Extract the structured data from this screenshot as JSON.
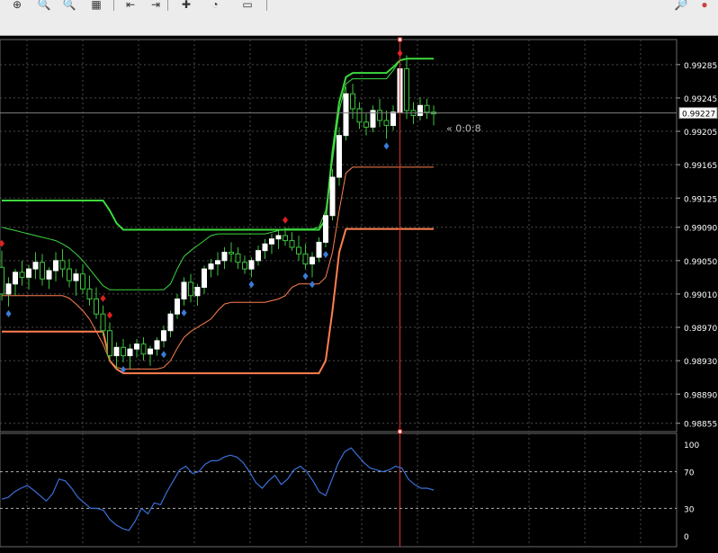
{
  "toolbar": {
    "buttons": [
      {
        "icon": "crosshair-icon",
        "glyph": "⊕"
      },
      {
        "icon": "zoom-in-icon",
        "glyph": "🔍"
      },
      {
        "icon": "zoom-out-icon",
        "glyph": "🔍"
      },
      {
        "icon": "tile-windows-icon",
        "glyph": "▦"
      },
      {
        "icon": "chart-shift-icon",
        "glyph": "⇤"
      },
      {
        "icon": "auto-scroll-icon",
        "glyph": "⇥"
      },
      {
        "icon": "indicators-icon",
        "glyph": "✚"
      },
      {
        "icon": "periods-icon",
        "glyph": "◔"
      },
      {
        "icon": "templates-icon",
        "glyph": "▭"
      }
    ],
    "right_icons": [
      {
        "icon": "search-icon",
        "glyph": "🔎"
      },
      {
        "icon": "notifications-icon",
        "glyph": "●"
      }
    ]
  },
  "colors": {
    "background": "#000000",
    "grid": "#4a4a4a",
    "candle_up": "#ffffff",
    "candle_down": "#ffffff",
    "wick": "#3cc43c",
    "outer_upper": "#3ed83e",
    "outer_lower": "#ff7f50",
    "inner_upper": "#3ed83e",
    "inner_lower": "#ff7f50",
    "signal_up": "#3a7bd5",
    "signal_down": "#e02020",
    "indicator_line": "#3b6fd8",
    "vertical_line": "#e03030",
    "price_line": "#808080",
    "axis_text": "#ffffff"
  },
  "chart_data": [
    {
      "type": "candlestick",
      "y_ticks": [
        "0.99285",
        "0.99245",
        "0.99205",
        "0.99165",
        "0.99125",
        "0.99090",
        "0.99050",
        "0.99010",
        "0.98970",
        "0.98930",
        "0.98890",
        "0.98855"
      ],
      "ylim": [
        0.98845,
        0.99315
      ],
      "current_price": "0.99227",
      "timer_label": "« 0:0:8",
      "candles": [
        [
          0.99042,
          0.99062,
          0.99002,
          0.9901
        ],
        [
          0.9901,
          0.9903,
          0.98995,
          0.99022
        ],
        [
          0.99022,
          0.9904,
          0.99008,
          0.99036
        ],
        [
          0.99036,
          0.9905,
          0.9902,
          0.9903
        ],
        [
          0.9903,
          0.99045,
          0.99015,
          0.9904
        ],
        [
          0.9904,
          0.9906,
          0.99028,
          0.99048
        ],
        [
          0.99048,
          0.99058,
          0.9902,
          0.99028
        ],
        [
          0.99028,
          0.99042,
          0.99016,
          0.99038
        ],
        [
          0.99038,
          0.9906,
          0.99025,
          0.9905
        ],
        [
          0.9905,
          0.99064,
          0.9903,
          0.9904
        ],
        [
          0.9904,
          0.99052,
          0.99018,
          0.99026
        ],
        [
          0.99026,
          0.9904,
          0.99008,
          0.99034
        ],
        [
          0.99034,
          0.99046,
          0.9901,
          0.99016
        ],
        [
          0.99016,
          0.99032,
          0.98996,
          0.99004
        ],
        [
          0.99004,
          0.99018,
          0.9898,
          0.98986
        ],
        [
          0.98986,
          0.98996,
          0.9896,
          0.98966
        ],
        [
          0.98966,
          0.98976,
          0.9893,
          0.98936
        ],
        [
          0.98936,
          0.98952,
          0.9892,
          0.98946
        ],
        [
          0.98946,
          0.98956,
          0.98928,
          0.98936
        ],
        [
          0.98936,
          0.9895,
          0.9892,
          0.98944
        ],
        [
          0.98944,
          0.98956,
          0.98934,
          0.9895
        ],
        [
          0.9895,
          0.98958,
          0.9893,
          0.98938
        ],
        [
          0.98938,
          0.98948,
          0.98924,
          0.98944
        ],
        [
          0.98944,
          0.98958,
          0.98936,
          0.98954
        ],
        [
          0.98954,
          0.98972,
          0.98946,
          0.98966
        ],
        [
          0.98966,
          0.9899,
          0.98958,
          0.98986
        ],
        [
          0.98986,
          0.9901,
          0.9898,
          0.99004
        ],
        [
          0.99004,
          0.9903,
          0.98996,
          0.99024
        ],
        [
          0.99024,
          0.99034,
          0.99,
          0.99008
        ],
        [
          0.99008,
          0.99022,
          0.98996,
          0.99018
        ],
        [
          0.99018,
          0.99044,
          0.9901,
          0.9904
        ],
        [
          0.9904,
          0.99052,
          0.9903,
          0.99046
        ],
        [
          0.99046,
          0.9906,
          0.99032,
          0.9905
        ],
        [
          0.9905,
          0.99066,
          0.9904,
          0.9906
        ],
        [
          0.9906,
          0.99072,
          0.99048,
          0.99058
        ],
        [
          0.99058,
          0.99066,
          0.9904,
          0.99048
        ],
        [
          0.99048,
          0.99056,
          0.99034,
          0.9904
        ],
        [
          0.9904,
          0.99054,
          0.9903,
          0.9905
        ],
        [
          0.9905,
          0.99068,
          0.99044,
          0.99062
        ],
        [
          0.99062,
          0.99076,
          0.99052,
          0.9907
        ],
        [
          0.9907,
          0.99082,
          0.99058,
          0.99076
        ],
        [
          0.99076,
          0.99086,
          0.99064,
          0.9908
        ],
        [
          0.9908,
          0.9909,
          0.99068,
          0.99074
        ],
        [
          0.99074,
          0.99084,
          0.99062,
          0.99066
        ],
        [
          0.99066,
          0.9908,
          0.9905,
          0.99058
        ],
        [
          0.99058,
          0.9907,
          0.9904,
          0.99046
        ],
        [
          0.99046,
          0.9906,
          0.9903,
          0.99054
        ],
        [
          0.99054,
          0.99078,
          0.99048,
          0.99072
        ],
        [
          0.99072,
          0.9911,
          0.99066,
          0.99104
        ],
        [
          0.99104,
          0.9916,
          0.99098,
          0.9915
        ],
        [
          0.9915,
          0.9921,
          0.9914,
          0.992
        ],
        [
          0.992,
          0.99258,
          0.99194,
          0.9925
        ],
        [
          0.9925,
          0.99262,
          0.9922,
          0.99232
        ],
        [
          0.99232,
          0.9924,
          0.99208,
          0.99216
        ],
        [
          0.99216,
          0.99226,
          0.992,
          0.9921
        ],
        [
          0.9921,
          0.99236,
          0.99204,
          0.9923
        ],
        [
          0.9923,
          0.99244,
          0.9921,
          0.99218
        ],
        [
          0.99218,
          0.9923,
          0.99196,
          0.99212
        ],
        [
          0.99212,
          0.99236,
          0.99206,
          0.99228
        ],
        [
          0.99228,
          0.9929,
          0.99222,
          0.9928
        ],
        [
          0.9928,
          0.99296,
          0.9922,
          0.9923
        ],
        [
          0.9923,
          0.9924,
          0.99214,
          0.99224
        ],
        [
          0.99224,
          0.99246,
          0.99218,
          0.99236
        ],
        [
          0.99236,
          0.99244,
          0.9922,
          0.99228
        ],
        [
          0.99228,
          0.99236,
          0.99212,
          0.99226
        ]
      ],
      "outer_upper": [
        0.99122,
        0.99122,
        0.99122,
        0.99122,
        0.99122,
        0.99122,
        0.99122,
        0.99122,
        0.99122,
        0.99122,
        0.99122,
        0.99122,
        0.99122,
        0.99122,
        0.99122,
        0.99122,
        0.9911,
        0.99095,
        0.99087,
        0.99087,
        0.99087,
        0.99087,
        0.99087,
        0.99087,
        0.99087,
        0.99087,
        0.99087,
        0.99087,
        0.99087,
        0.99087,
        0.99087,
        0.99087,
        0.99087,
        0.99087,
        0.99087,
        0.99087,
        0.99087,
        0.99087,
        0.99087,
        0.99087,
        0.99087,
        0.99087,
        0.99087,
        0.99087,
        0.99087,
        0.99087,
        0.99087,
        0.99087,
        0.991,
        0.9918,
        0.9924,
        0.9927,
        0.99275,
        0.99275,
        0.99275,
        0.99275,
        0.99275,
        0.99275,
        0.99282,
        0.9929,
        0.99292,
        0.99292,
        0.99292,
        0.99292,
        0.99292
      ],
      "outer_lower": [
        0.98965,
        0.98965,
        0.98965,
        0.98965,
        0.98965,
        0.98965,
        0.98965,
        0.98965,
        0.98965,
        0.98965,
        0.98965,
        0.98965,
        0.98965,
        0.98965,
        0.98965,
        0.98965,
        0.9893,
        0.9892,
        0.98915,
        0.98915,
        0.98915,
        0.98915,
        0.98915,
        0.98915,
        0.98915,
        0.98915,
        0.98915,
        0.98915,
        0.98915,
        0.98915,
        0.98915,
        0.98915,
        0.98915,
        0.98915,
        0.98915,
        0.98915,
        0.98915,
        0.98915,
        0.98915,
        0.98915,
        0.98915,
        0.98915,
        0.98915,
        0.98915,
        0.98915,
        0.98915,
        0.98915,
        0.98915,
        0.9893,
        0.9899,
        0.9906,
        0.99088,
        0.99088,
        0.99088,
        0.99088,
        0.99088,
        0.99088,
        0.99088,
        0.99088,
        0.99088,
        0.99088,
        0.99088,
        0.99088,
        0.99088,
        0.99088
      ],
      "inner_upper": [
        0.9909,
        0.99088,
        0.99086,
        0.99084,
        0.99082,
        0.9908,
        0.99078,
        0.99076,
        0.99074,
        0.9907,
        0.99065,
        0.99058,
        0.9905,
        0.9904,
        0.9903,
        0.9902,
        0.99015,
        0.99015,
        0.99015,
        0.99015,
        0.99015,
        0.99015,
        0.99015,
        0.99015,
        0.99015,
        0.99022,
        0.9904,
        0.99055,
        0.99062,
        0.99068,
        0.99074,
        0.9908,
        0.99082,
        0.99082,
        0.99082,
        0.99082,
        0.99082,
        0.99082,
        0.99082,
        0.99082,
        0.99084,
        0.99086,
        0.99088,
        0.99088,
        0.99088,
        0.99088,
        0.99088,
        0.9909,
        0.9911,
        0.9917,
        0.9923,
        0.99262,
        0.99268,
        0.99268,
        0.99268,
        0.99268,
        0.99268,
        0.99268,
        0.99278,
        0.9929,
        0.99292,
        0.99292,
        0.99292,
        0.99292,
        0.99292
      ],
      "inner_lower": [
        0.99008,
        0.99008,
        0.99008,
        0.99008,
        0.99008,
        0.99008,
        0.99008,
        0.99008,
        0.99008,
        0.99008,
        0.99005,
        0.98998,
        0.9899,
        0.9898,
        0.98965,
        0.9895,
        0.9893,
        0.98922,
        0.9892,
        0.9892,
        0.9892,
        0.9892,
        0.9892,
        0.9892,
        0.98922,
        0.9893,
        0.98945,
        0.98958,
        0.98965,
        0.9897,
        0.98975,
        0.9898,
        0.9899,
        0.98998,
        0.99,
        0.99,
        0.99,
        0.99,
        0.99,
        0.99,
        0.99002,
        0.99004,
        0.99008,
        0.99018,
        0.99022,
        0.99022,
        0.99022,
        0.99022,
        0.9903,
        0.9906,
        0.9911,
        0.99155,
        0.99162,
        0.99162,
        0.99162,
        0.99162,
        0.99162,
        0.99162,
        0.99162,
        0.99162,
        0.99162,
        0.99162,
        0.99162,
        0.99162,
        0.99162
      ],
      "signals": [
        {
          "i": 0,
          "dir": "down"
        },
        {
          "i": 1,
          "dir": "up"
        },
        {
          "i": 15,
          "dir": "down"
        },
        {
          "i": 16,
          "dir": "down"
        },
        {
          "i": 18,
          "dir": "up"
        },
        {
          "i": 24,
          "dir": "up"
        },
        {
          "i": 27,
          "dir": "up"
        },
        {
          "i": 37,
          "dir": "up"
        },
        {
          "i": 42,
          "dir": "down"
        },
        {
          "i": 45,
          "dir": "up"
        },
        {
          "i": 46,
          "dir": "up"
        },
        {
          "i": 48,
          "dir": "up"
        },
        {
          "i": 57,
          "dir": "up"
        },
        {
          "i": 59,
          "dir": "down"
        }
      ],
      "vertical_line_index": 59
    },
    {
      "type": "line",
      "y_ticks": [
        "100",
        "70",
        "30",
        "0"
      ],
      "ylim": [
        0,
        100
      ],
      "levels": [
        70,
        30
      ],
      "values": [
        40,
        42,
        48,
        52,
        55,
        50,
        44,
        38,
        46,
        62,
        60,
        52,
        42,
        36,
        30,
        30,
        28,
        18,
        12,
        8,
        6,
        16,
        30,
        24,
        36,
        34,
        48,
        60,
        72,
        76,
        68,
        70,
        78,
        82,
        82,
        86,
        88,
        86,
        80,
        70,
        58,
        52,
        60,
        66,
        56,
        62,
        72,
        76,
        70,
        60,
        48,
        44,
        62,
        80,
        92,
        96,
        88,
        80,
        74,
        72,
        70,
        72,
        76,
        74,
        62,
        56,
        52,
        52,
        50
      ]
    }
  ]
}
